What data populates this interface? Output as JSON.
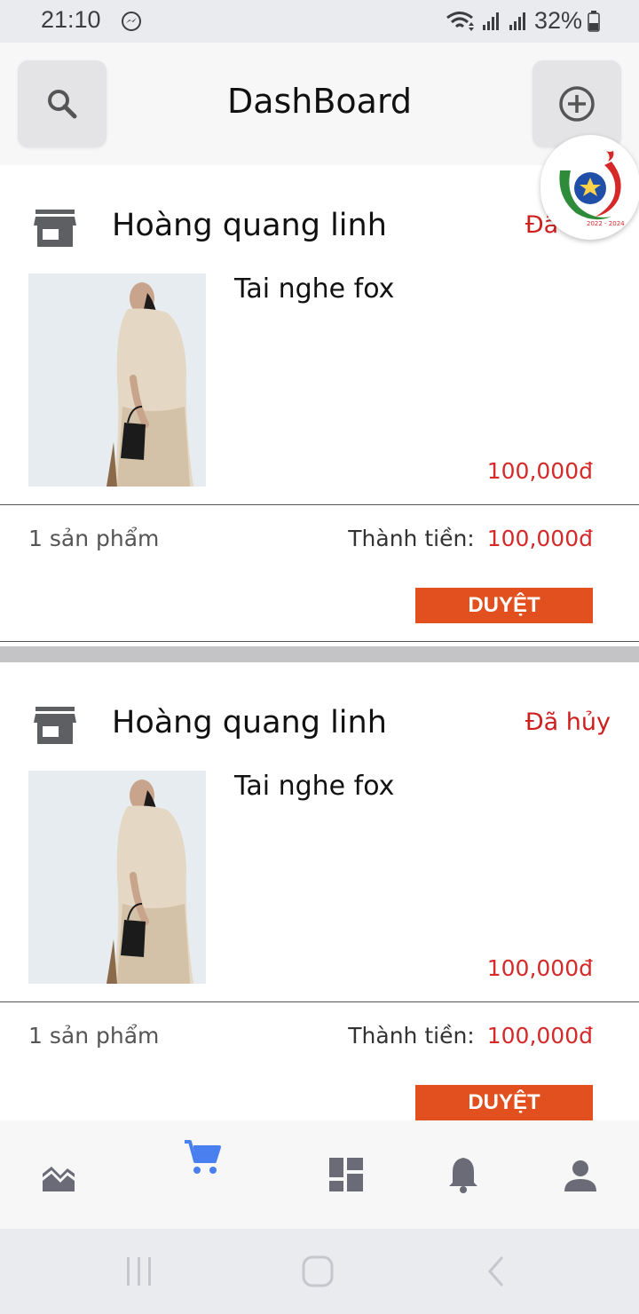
{
  "status_bar": {
    "time": "21:10",
    "battery": "32%"
  },
  "header": {
    "title": "DashBoard",
    "left_icon": "search-icon",
    "right_icon": "add-circle-icon"
  },
  "badge": {
    "logo_text": "2022 - 2024"
  },
  "orders": [
    {
      "shop_name": "Hoàng quang linh",
      "status": "Đã hủy",
      "product_name": "Tai nghe fox",
      "price": "100,000đ",
      "item_count": "1 sản phẩm",
      "total_label": "Thành tiền:",
      "total_value": "100,000đ",
      "action_label": "DUYỆT"
    },
    {
      "shop_name": "Hoàng quang linh",
      "status": "Đã hủy",
      "product_name": "Tai nghe fox",
      "price": "100,000đ",
      "item_count": "1 sản phẩm",
      "total_label": "Thành tiền:",
      "total_value": "100,000đ",
      "action_label": "DUYỆT"
    }
  ],
  "bottom_nav": {
    "items": [
      {
        "icon": "chart-icon",
        "active": false
      },
      {
        "icon": "cart-icon",
        "active": true
      },
      {
        "icon": "dashboard-icon",
        "active": false
      },
      {
        "icon": "bell-icon",
        "active": false
      },
      {
        "icon": "person-icon",
        "active": false
      }
    ]
  },
  "colors": {
    "accent_red": "#d42a2a",
    "button_orange": "#e1501e",
    "active_blue": "#4a7ff0",
    "inactive_gray": "#6b6b78"
  }
}
